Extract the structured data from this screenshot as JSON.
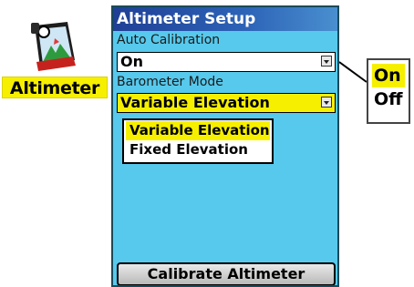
{
  "app": {
    "label": "Altimeter"
  },
  "screen": {
    "title": "Altimeter Setup",
    "auto_calibration": {
      "label": "Auto Calibration",
      "value": "On"
    },
    "barometer_mode": {
      "label": "Barometer Mode",
      "value": "Variable Elevation",
      "options": [
        "Variable Elevation",
        "Fixed Elevation"
      ]
    },
    "calibrate_button": "Calibrate Altimeter"
  },
  "callout": {
    "options": [
      "On",
      "Off"
    ]
  },
  "colors": {
    "screen_bg": "#57c9ec",
    "highlight": "#f6f000",
    "title_bar": "#1f3f95"
  },
  "icons": [
    "altimeter-app-icon",
    "dropdown-arrow-icon"
  ]
}
